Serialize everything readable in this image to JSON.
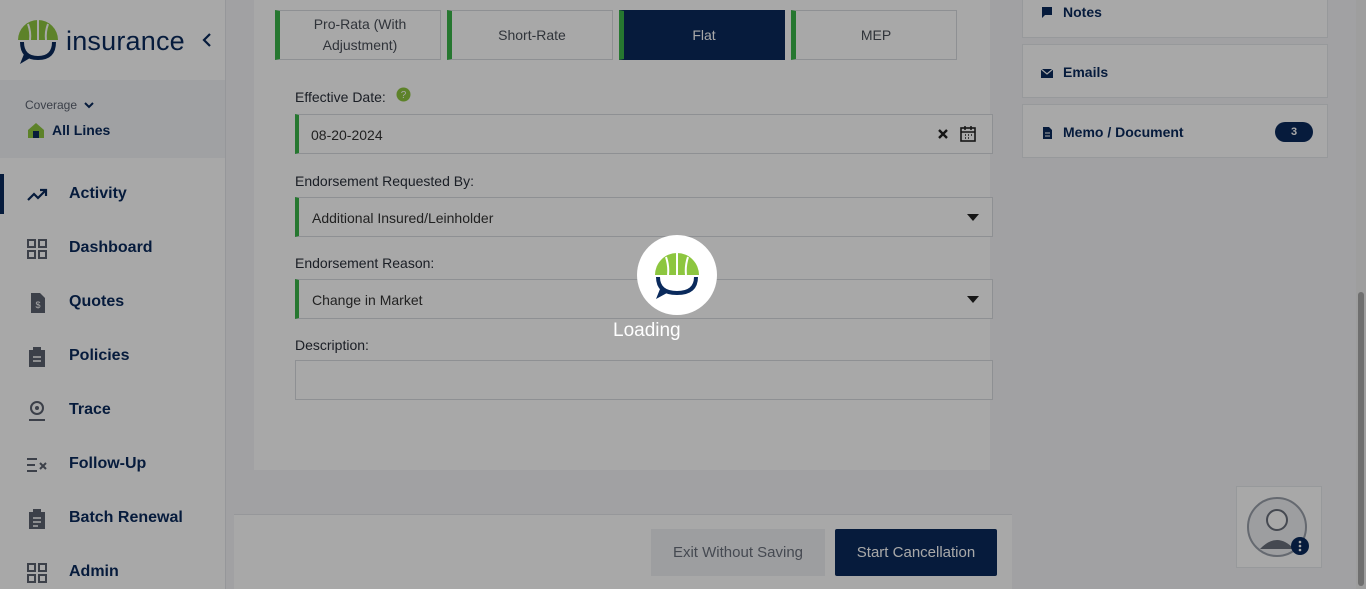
{
  "brand": {
    "logo_text": "insurance"
  },
  "coverage": {
    "label": "Coverage",
    "value": "All Lines"
  },
  "nav": [
    {
      "label": "Activity",
      "icon": "trending-up-icon",
      "active": true
    },
    {
      "label": "Dashboard",
      "icon": "grid-icon"
    },
    {
      "label": "Quotes",
      "icon": "quote-doc-icon"
    },
    {
      "label": "Policies",
      "icon": "clipboard-icon"
    },
    {
      "label": "Trace",
      "icon": "location-pin-icon"
    },
    {
      "label": "Follow-Up",
      "icon": "checklist-icon"
    },
    {
      "label": "Batch Renewal",
      "icon": "clipboard-list-icon"
    },
    {
      "label": "Admin",
      "icon": "grid-icon"
    }
  ],
  "rate_tabs": [
    {
      "label": "Pro-Rata (With Adjustment)"
    },
    {
      "label": "Short-Rate"
    },
    {
      "label": "Flat",
      "active": true
    },
    {
      "label": "MEP"
    }
  ],
  "form": {
    "effective_date_label": "Effective Date:",
    "effective_date_value": "08-20-2024",
    "requested_by_label": "Endorsement Requested By:",
    "requested_by_value": "Additional Insured/Leinholder",
    "reason_label": "Endorsement Reason:",
    "reason_value": "Change in Market",
    "description_label": "Description:",
    "description_value": ""
  },
  "footer": {
    "exit_label": "Exit Without Saving",
    "start_label": "Start Cancellation"
  },
  "right_panel": {
    "notes_label": "Notes",
    "emails_label": "Emails",
    "memo_label": "Memo / Document",
    "memo_count": "3"
  },
  "loading": {
    "text": "Loading"
  },
  "colors": {
    "navy": "#0a2a5c",
    "green": "#3bb54a",
    "lime": "#8dc63f"
  }
}
